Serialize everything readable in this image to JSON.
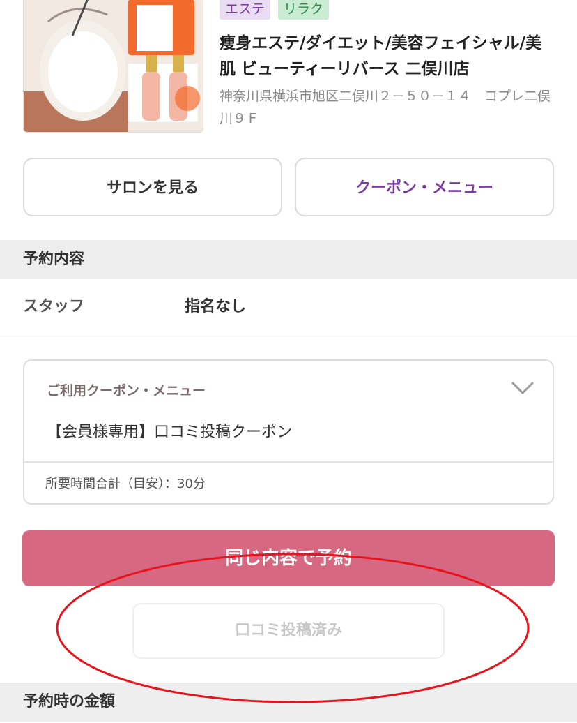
{
  "salon": {
    "tags": [
      "エステ",
      "リラク"
    ],
    "name": "痩身エステ/ダイエット/美容フェイシャル/美肌 ビューティーリバース 二俣川店",
    "address": "神奈川県横浜市旭区二俣川２－５０－１４　コプレ二俣川９Ｆ",
    "view_salon_label": "サロンを見る",
    "coupon_menu_label": "クーポン・メニュー"
  },
  "reservation": {
    "section_title": "予約内容",
    "staff_label": "スタッフ",
    "staff_value": "指名なし",
    "coupon_heading": "ご利用クーポン・メニュー",
    "coupon_item": "【会員様専用】口コミ投稿クーポン",
    "duration_text": "所要時間合計（目安）：30分",
    "rebook_label": "同じ内容で予約",
    "review_posted_label": "口コミ投稿済み"
  },
  "price": {
    "section_title": "予約時の金額"
  },
  "colors": {
    "accent_purple": "#7b3aa5",
    "rebook_pink": "#d66882",
    "annotation_red": "#e8141c"
  }
}
